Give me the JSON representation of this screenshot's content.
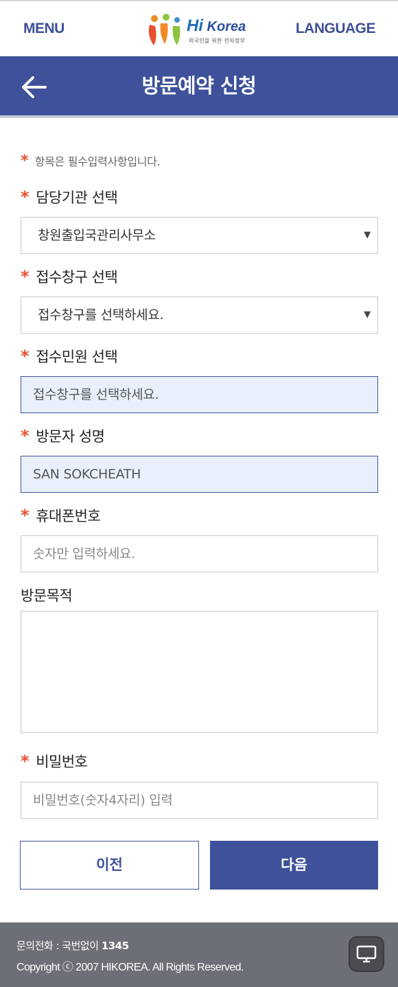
{
  "header": {
    "menu_label": "MENU",
    "language_label": "LANGUAGE",
    "logo_text_hi": "Hi",
    "logo_text_korea": " Korea",
    "logo_subtitle": "외국인을 위한 전자정부"
  },
  "titlebar": {
    "title": "방문예약 신청",
    "back_icon": "arrow-left-icon"
  },
  "form": {
    "required_note": "항목은 필수입력사항입니다.",
    "required_mark": "*",
    "agency": {
      "label": "담당기관 선택",
      "selected": "창원출입국관리사무소"
    },
    "counter": {
      "label": "접수창구 선택",
      "selected": "접수창구를 선택하세요."
    },
    "service": {
      "label": "접수민원 선택",
      "value": "접수창구를 선택하세요."
    },
    "visitor_name": {
      "label": "방문자 성명",
      "value": "SAN SOKCHEATH"
    },
    "phone": {
      "label": "휴대폰번호",
      "placeholder": "숫자만 입력하세요."
    },
    "purpose": {
      "label": "방문목적",
      "value": ""
    },
    "password": {
      "label": "비밀번호",
      "placeholder": "비밀번호(숫자4자리) 입력"
    }
  },
  "buttons": {
    "prev_label": "이전",
    "next_label": "다음"
  },
  "footer": {
    "contact_prefix": "문의전화 : 국번없이 ",
    "contact_number": "1345",
    "copyright": "Copyright ⓒ 2007 HIKOREA. All Rights Reserved.",
    "pc_icon": "monitor-icon"
  },
  "colors": {
    "primary": "#3e519a",
    "required": "#e8502f",
    "footer_bg": "#6d6f76",
    "filled_bg": "#e9f0fc"
  }
}
